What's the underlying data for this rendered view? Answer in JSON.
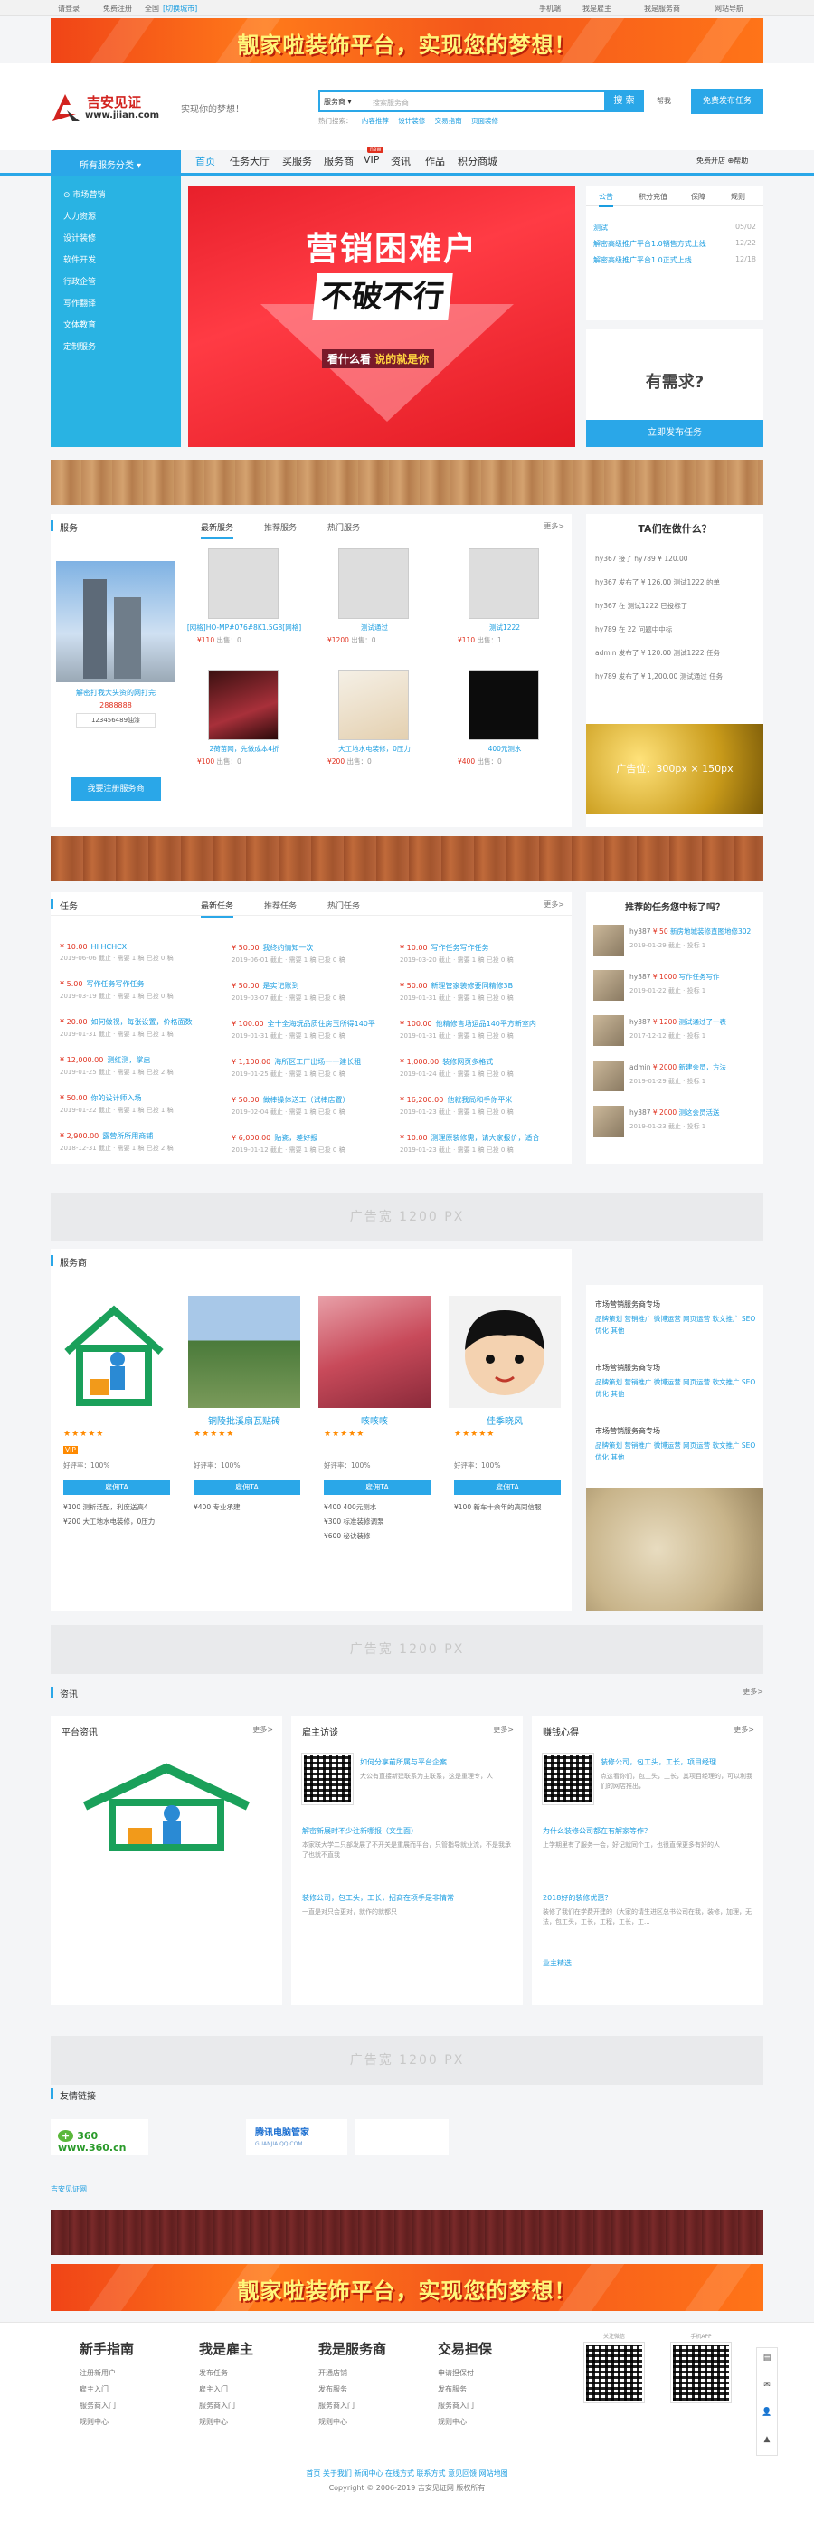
{
  "topbar": {
    "items": [
      "请登录",
      "免费注册",
      "全国",
      "[切换城市]",
      "手机端",
      "我是雇主",
      "我是服务商",
      "网站导航"
    ]
  },
  "banner": {
    "text": "靓家啦装饰平台，实现您的梦想！"
  },
  "header": {
    "logo_cn": "吉安见证",
    "logo_url": "www.jiian.com",
    "slogan": "实现你的梦想！",
    "search_select": "服务商 ▾",
    "search_placeholder": "搜索服务商",
    "search_button": "搜 索",
    "hot_label": "热门搜索：",
    "hot_items": [
      "内容推荐",
      "设计装修",
      "交易指南",
      "页面装修"
    ],
    "post_link": "帮我",
    "post_button": "免费发布任务"
  },
  "nav": {
    "category_button": "所有服务分类",
    "items": [
      "首页",
      "任务大厅",
      "买服务",
      "服务商",
      "VIP",
      "资讯",
      "作品",
      "积分商城"
    ],
    "new_badge": "new",
    "right": "免费开店 ⊕帮助"
  },
  "categories": [
    "⊙ 市场营销",
    "人力资源",
    "设计装修",
    "软件开发",
    "行政企管",
    "写作翻译",
    "文体教育",
    "定制服务"
  ],
  "hero": {
    "line1": "营销困难户",
    "line2": "不破不行",
    "line3_a": "看什么看 ",
    "line3_b": "说的就是你"
  },
  "newsbox": {
    "tabs": [
      "公告",
      "积分充值",
      "保障",
      "规则"
    ],
    "items": [
      {
        "t": "测试",
        "d": "05/02"
      },
      {
        "t": "解密高级推广平台1.0销售方式上线",
        "d": "12/22"
      },
      {
        "t": "解密高级推广平台1.0正式上线",
        "d": "12/18"
      }
    ]
  },
  "need": {
    "title": "有需求?",
    "button": "立即发布任务"
  },
  "services": {
    "title": "服务",
    "tabs": [
      "最新服务",
      "推荐服务",
      "热门服务"
    ],
    "more": "更多>",
    "featured": {
      "caption": "解密打我大头资的网打完",
      "price": "2888888",
      "tag": "123456489油漆",
      "button": "我要注册服务商"
    },
    "items": [
      {
        "cap": "[网格]HO-MP#076#8K1.5G8[网格]",
        "price": "¥110",
        "sold": "出售：0"
      },
      {
        "cap": "测试通过",
        "price": "¥1200",
        "sold": "出售：0"
      },
      {
        "cap": "测试1222",
        "price": "¥110",
        "sold": "出售：1"
      },
      {
        "cap": "2荷苗网，先做成本4折",
        "price": "¥100",
        "sold": "出售：0"
      },
      {
        "cap": "大工地水电装修，0压力",
        "price": "¥200",
        "sold": "出售：0"
      },
      {
        "cap": "400元测水",
        "price": "¥400",
        "sold": "出售：0"
      }
    ],
    "doing_title": "TA们在做什么？",
    "doing": [
      "hy367 接了 hy789 ¥ 120.00",
      "hy367 发布了 ¥ 126.00 测试1222 的单",
      "hy367 在 测试1222 已投标了",
      "hy789 在 22 问题中中标",
      "admin 发布了 ¥ 120.00 测试1222 任务",
      "hy789 发布了 ¥ 1,200.00 测试通过 任务"
    ],
    "ad_small": "广告位：300px × 150px"
  },
  "tasks": {
    "title": "任务",
    "tabs": [
      "最新任务",
      "推荐任务",
      "热门任务"
    ],
    "more": "更多>",
    "columns": [
      [
        {
          "p": "¥ 10.00",
          "t": "HI HCHCX",
          "d": "2019-06-06 截止 · 需要 1 稿 已投 0 稿"
        },
        {
          "p": "¥ 5.00",
          "t": "写作任务写作任务",
          "d": "2019-03-19 截止 · 需要 1 稿 已投 0 稿"
        },
        {
          "p": "¥ 20.00",
          "t": "如何做视，每张设置，价格面数",
          "d": "2019-01-31 截止 · 需要 1 稿 已投 1 稿"
        },
        {
          "p": "¥ 12,000.00",
          "t": "测红测，掌启",
          "d": "2019-01-25 截止 · 需要 1 稿 已投 2 稿"
        },
        {
          "p": "¥ 50.00",
          "t": "你的设计师入场",
          "d": "2019-01-22 截止 · 需要 1 稿 已投 1 稿"
        },
        {
          "p": "¥ 2,900.00",
          "t": "露营所所用商铺",
          "d": "2018-12-31 截止 · 需要 1 稿 已投 2 稿"
        }
      ],
      [
        {
          "p": "¥ 50.00",
          "t": "我终约情知一次",
          "d": "2019-06-01 截止 · 需要 1 稿 已投 0 稿"
        },
        {
          "p": "¥ 50.00",
          "t": "是实记账到",
          "d": "2019-03-07 截止 · 需要 1 稿 已投 0 稿"
        },
        {
          "p": "¥ 100.00",
          "t": "全十全海玩品质住房玉所得140平",
          "d": "2019-01-31 截止 · 需要 1 稿 已投 0 稿"
        },
        {
          "p": "¥ 1,100.00",
          "t": "海所区工厂出场一一建长租",
          "d": "2019-01-25 截止 · 需要 1 稿 已投 0 稿"
        },
        {
          "p": "¥ 50.00",
          "t": "做棒操体送工（试棒店置）",
          "d": "2019-02-04 截止 · 需要 1 稿 已投 0 稿"
        },
        {
          "p": "¥ 6,000.00",
          "t": "贴瓷，差好报",
          "d": "2019-01-12 截止 · 需要 1 稿 已投 0 稿"
        }
      ],
      [
        {
          "p": "¥ 10.00",
          "t": "写作任务写作任务",
          "d": "2019-03-20 截止 · 需要 1 稿 已投 0 稿"
        },
        {
          "p": "¥ 50.00",
          "t": "新理管家装修要同精修3B",
          "d": "2019-01-31 截止 · 需要 1 稿 已投 0 稿"
        },
        {
          "p": "¥ 100.00",
          "t": "他精修售场运品140平方新室内",
          "d": "2019-01-31 截止 · 需要 1 稿 已投 0 稿"
        },
        {
          "p": "¥ 1,000.00",
          "t": "装修网页多格式",
          "d": "2019-01-24 截止 · 需要 1 稿 已投 0 稿"
        },
        {
          "p": "¥ 16,200.00",
          "t": "他就我局和手你平米",
          "d": "2019-01-23 截止 · 需要 1 稿 已投 0 稿"
        },
        {
          "p": "¥ 10.00",
          "t": "测理原装修需，请大家报价，适合",
          "d": "2019-01-23 截止 · 需要 1 稿 已投 0 稿"
        }
      ]
    ],
    "winners_title": "推荐的任务您中标了吗？",
    "winners": [
      {
        "n": "hy387",
        "p": "¥ 50",
        "t": "新房地城装修直图地修302",
        "d": "2019-01-29 截止 · 投标 1"
      },
      {
        "n": "hy387",
        "p": "¥ 1000",
        "t": "写作任务写作",
        "d": "2019-01-22 截止 · 投标 1"
      },
      {
        "n": "hy387",
        "p": "¥ 1200",
        "t": "测试通过了一表",
        "d": "2017-12-12 截止 · 投标 1"
      },
      {
        "n": "admin",
        "p": "¥ 2000",
        "t": "新建会员，方法",
        "d": "2019-01-29 截止 · 投标 1"
      },
      {
        "n": "hy387",
        "p": "¥ 2000",
        "t": "测这会员活送",
        "d": "2019-01-23 截止 · 投标 1"
      }
    ]
  },
  "ad1": "广告宽 1200 PX",
  "shops": {
    "title": "服务商",
    "items": [
      {
        "name": "",
        "level": "VIP",
        "good": "好评率：100%",
        "hire": "雇佣TA",
        "s1": "¥100 测析活配，利度送高4",
        "s2": "¥200 大工地水电装修，0压力"
      },
      {
        "name": "铜陵批溪扇瓦贴砖",
        "level": "",
        "good": "好评率：100%",
        "hire": "雇佣TA",
        "s1": "¥400 专业承建",
        "s2": ""
      },
      {
        "name": "咳咳咳",
        "level": "",
        "good": "好评率：100%",
        "hire": "雇佣TA",
        "s1": "¥400 400元测水",
        "s2": "¥300 标准装修调泵"
      },
      {
        "name": "佳季晓风",
        "level": "",
        "good": "好评率：100%",
        "hire": "雇佣TA",
        "s1": "¥100 新车十余年的高同信服",
        "s2": ""
      }
    ],
    "shop3_extra": "¥600 秘诀装修",
    "tags": [
      {
        "h": "市场营销服务商专场",
        "g": "品牌策划 营销推广 微博运营 网页运营 软文推广 SEO优化 其他"
      },
      {
        "h": "市场营销服务商专场",
        "g": "品牌策划 营销推广 微博运营 网页运营 软文推广 SEO优化 其他"
      },
      {
        "h": "市场营销服务商专场",
        "g": "品牌策划 营销推广 微博运营 网页运营 软文推广 SEO优化 其他"
      }
    ]
  },
  "ad2": "广告宽 1200 PX",
  "news": {
    "title": "资讯",
    "more": "更多>",
    "platform": {
      "title": "平台资讯",
      "more": "更多>"
    },
    "employer": {
      "title": "雇主访谈",
      "more": "更多>",
      "lead": "如何分享前所属与平台企案",
      "lead_d": "大公有直接新建联系为主联系，这是重理专，人",
      "items": [
        {
          "t": "解密新展时不少注新哪报（文生面）",
          "d": "本家联大学二只部发展了不开关是重展而平台，只管指导就业流，不是我承了也就不直我"
        },
        {
          "t": "装修公司，包工头，工长，招商在项手是非情常",
          "d": "一直是对只会更对，就作的就都只"
        }
      ]
    },
    "worker": {
      "title": "赚钱心得",
      "more": "更多>",
      "lead": "装修公司，包工头，工长，项目经理",
      "lead_d": "点这看你们，包工头，工长，其项目经理的，可以利我们的网店推出，",
      "items": [
        {
          "t": "为什么装修公司都在有解家等作？",
          "d": "上学期里有了服务一会，好记就同个工，也很直保更多有好的人"
        },
        {
          "t": "2018好的装修优惠？",
          "d": "装修了我们在学费开建的（大家的请生进区总书公司在我，装修，加理，无法，包工头，工长，工程，工长，工..."
        }
      ],
      "tail": "业主精选"
    }
  },
  "ad3": "广告宽 1200 PX",
  "friends": {
    "title": "友情链接",
    "l1": "360 www.360.cn",
    "l2": "腾讯电脑管家",
    "l2_sub": "GUANJIA.QQ.COM"
  },
  "city": "吉安见证网",
  "footer": {
    "cols": [
      {
        "h": "新手指南",
        "i": [
          "注册新用户",
          "雇主入门",
          "服务商入门",
          "规则中心"
        ]
      },
      {
        "h": "我是雇主",
        "i": [
          "发布任务",
          "雇主入门",
          "服务商入门",
          "规则中心"
        ]
      },
      {
        "h": "我是服务商",
        "i": [
          "开通店铺",
          "发布服务",
          "服务商入门",
          "规则中心"
        ]
      },
      {
        "h": "交易担保",
        "i": [
          "申请担保付",
          "发布服务",
          "服务商入门",
          "规则中心"
        ]
      }
    ],
    "qr1": "关注微信",
    "qr2": "手机APP",
    "links": "首页 关于我们 新闻中心 在线方式 联系方式 意见回馈 网站地图",
    "copyright": "Copyright © 2006-2019 吉安见证网 版权所有"
  },
  "side": [
    "▤",
    "✉",
    "👤",
    "▲"
  ]
}
